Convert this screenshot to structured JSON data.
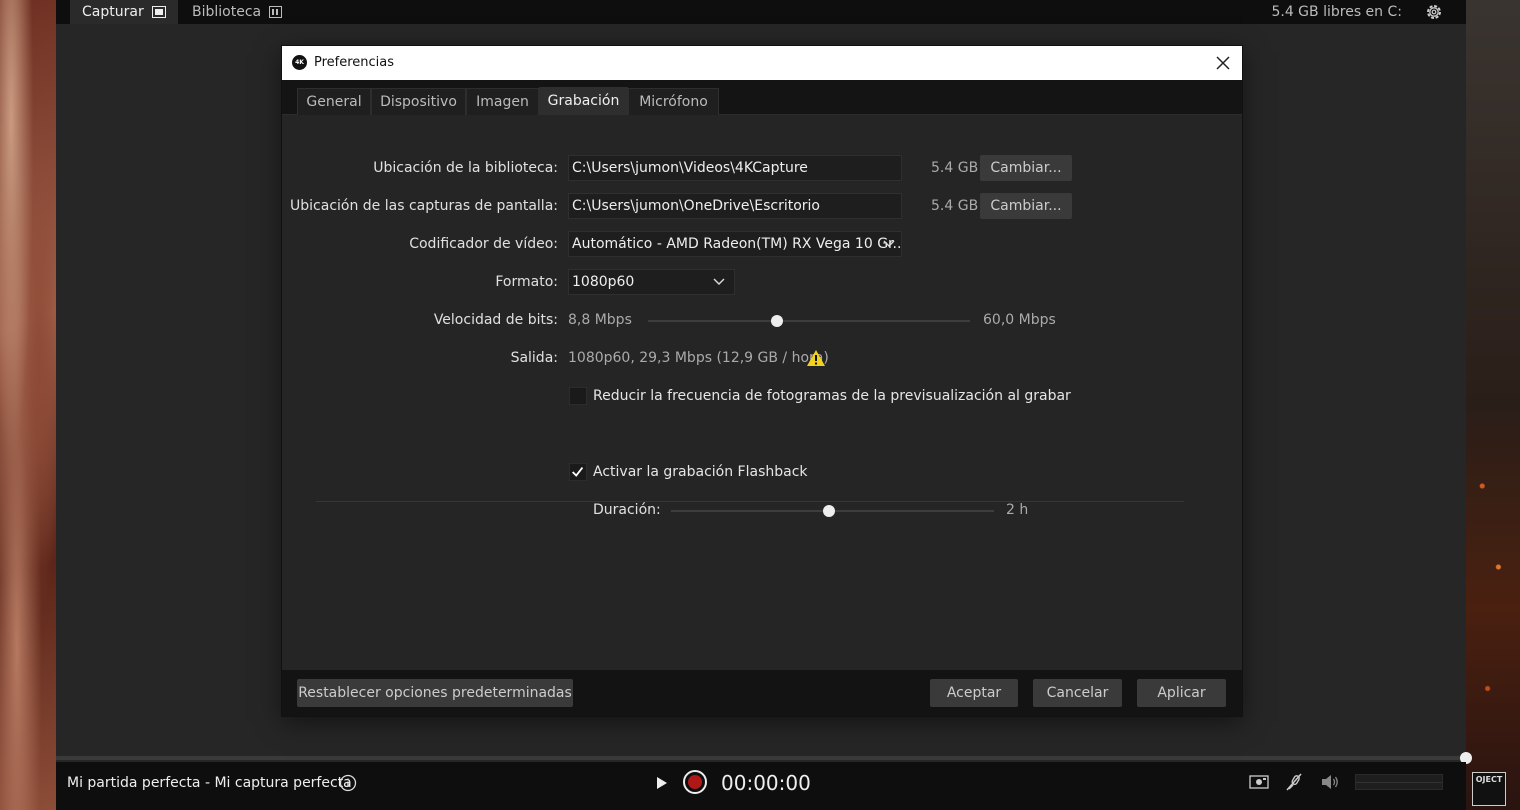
{
  "app": {
    "tabs": [
      {
        "label": "Capturar",
        "icon": "capture-icon"
      },
      {
        "label": "Biblioteca",
        "icon": "library-icon"
      }
    ],
    "free_space": "5.4 GB libres en C:",
    "project_name": "Mi partida perfecta - Mi captura perfecta",
    "timer": "00:00:00",
    "accent_record_color": "#b01818"
  },
  "dialog": {
    "title": "Preferencias",
    "app_icon_text": "4K",
    "tabs": [
      "General",
      "Dispositivo",
      "Imagen",
      "Grabación",
      "Micrófono"
    ],
    "active_tab": "Grabación",
    "library_location": {
      "label": "Ubicación de la biblioteca:",
      "value": "C:\\Users\\jumon\\Videos\\4KCapture",
      "size": "5.4 GB",
      "button": "Cambiar..."
    },
    "screenshots_location": {
      "label": "Ubicación de las capturas de pantalla:",
      "value": "C:\\Users\\jumon\\OneDrive\\Escritorio",
      "size": "5.4 GB",
      "button": "Cambiar..."
    },
    "video_encoder": {
      "label": "Codificador de vídeo:",
      "value": "Automático - AMD Radeon(TM) RX Vega 10 Gr..."
    },
    "format": {
      "label": "Formato:",
      "value": "1080p60"
    },
    "bitrate": {
      "label": "Velocidad de bits:",
      "min": "8,8 Mbps",
      "max": "60,0 Mbps",
      "level_fraction": 0.4
    },
    "output": {
      "label": "Salida:",
      "value": "1080p60, 29,3 Mbps (12,9 GB / hora)",
      "warning_icon": "warning-icon"
    },
    "reduce_preview": {
      "label": "Reducir la frecuencia de fotogramas de la previsualización al grabar",
      "checked": false
    },
    "flashback": {
      "label": "Activar la grabación Flashback",
      "checked": true
    },
    "duration": {
      "label": "Duración:",
      "value": "2 h",
      "level_fraction": 0.49
    },
    "footer": {
      "reset": "Restablecer opciones predeterminadas",
      "accept": "Aceptar",
      "cancel": "Cancelar",
      "apply": "Aplicar"
    }
  }
}
